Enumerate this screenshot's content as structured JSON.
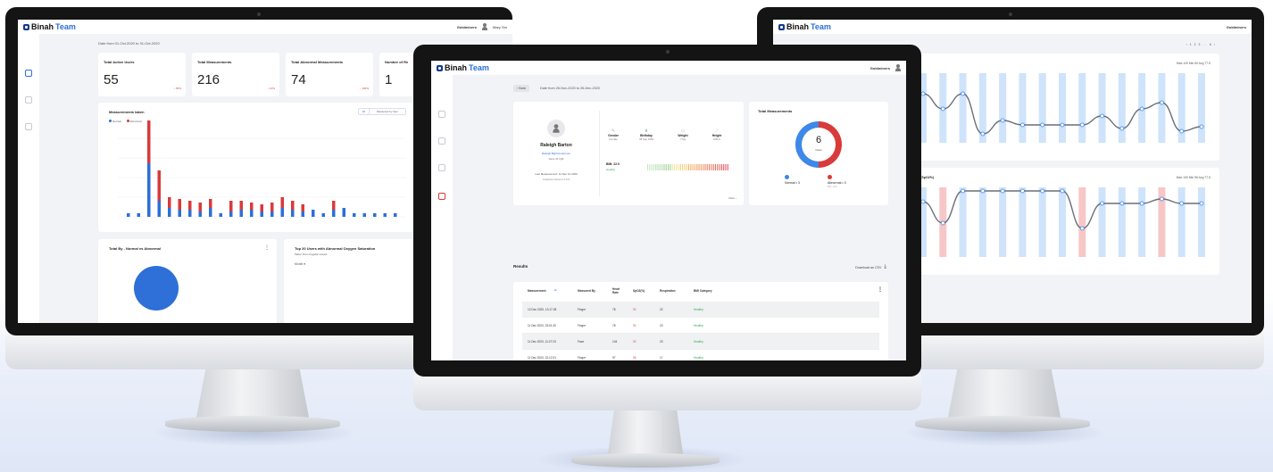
{
  "brand": {
    "word1": "Binah",
    "word2": "Team"
  },
  "left_screen": {
    "user_name": "Goldminers",
    "user_name_short": "Mary Sm",
    "date_range": "Date from 01-Oct-2020 to 31-Oct-2020",
    "stats": [
      {
        "label": "Total Active Users",
        "value": "55",
        "pct": "↓ 50%"
      },
      {
        "label": "Total Measurements",
        "value": "216",
        "pct": "↓ 10%"
      },
      {
        "label": "Total Abnormal Measurements",
        "value": "74",
        "pct": "↓ 100%"
      },
      {
        "label": "Number of Re",
        "value": "1",
        "pct": ""
      }
    ],
    "chart": {
      "title": "Measurements taken",
      "toggle_all": "All",
      "toggle_measured": "Measured by Item",
      "legend": [
        "Normal",
        "Abnormal"
      ]
    },
    "bottom_cards": [
      {
        "title": "Total By - Normal vs Abnormal"
      },
      {
        "title": "Top 20 Users with Abnormal Oxygen Saturation",
        "subtitle": "Taken from irregular results",
        "col": "Month ▾"
      }
    ]
  },
  "center_screen": {
    "user_name": "Goldminers",
    "back_label": "‹ Back",
    "date_range": "Date from 26-Nov-2020 to 26-Dec-2020",
    "profile": {
      "name": "Raleigh Barton",
      "email": "Raleigh.B@hotmail.com",
      "joined": "Joins 31 Q11",
      "last_measurement": "Last Measurement: 11 Dec 12 2020",
      "version": "Analytics Version 3.0.6",
      "gender_label": "Gender",
      "gender_value": "Female",
      "birthday_label": "Birthday",
      "birthday_value": "08 Sep 1962",
      "weight_label": "Weight",
      "weight_value": "77kg",
      "height_label": "Height",
      "height_value": "165cm",
      "bmi_label": "BMI: 22.9",
      "bmi_status": "Healthy",
      "more_label": "More ›"
    },
    "total_card": {
      "title": "Total Measurements",
      "count": "6",
      "count_label": "Meas",
      "normal_label": "Normal • 3",
      "abnormal_label": "Abnormal • 3",
      "abnormal_sub": "6.5 - 2.1"
    },
    "results": {
      "title": "Results",
      "download": "Download as CSV",
      "headers": [
        "Measurement",
        "Measured By",
        "Heart Rate",
        "SpO2(%)",
        "Respiration",
        "BMI Category"
      ],
      "rows": [
        [
          "12 Dec 2020, 13:17:28",
          "Finger",
          "78",
          "92",
          "22",
          "Healthy"
        ],
        [
          "11 Dec 2020, 23:01:20",
          "Finger",
          "78",
          "92",
          "23",
          "Healthy"
        ],
        [
          "11 Dec 2020, 11:27:23",
          "Face",
          "104",
          "92",
          "23",
          "Healthy"
        ],
        [
          "11 Dec 2020, 22:12:21",
          "Finger",
          "97",
          "96",
          "17",
          "Healthy"
        ]
      ]
    }
  },
  "right_screen": {
    "user_name": "Goldminers",
    "pagination": "‹ 1 2 3 ... 6 ›",
    "chart1_stats": "Max 115  Min 60  Avg 77.5",
    "chart2_title": "n (SpO2%)",
    "chart2_stats": "Max 100  Min 96  Avg 77.5"
  }
}
